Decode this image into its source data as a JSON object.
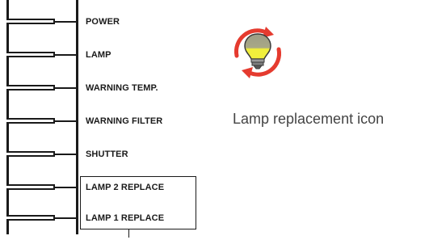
{
  "indicators": [
    {
      "label": "POWER"
    },
    {
      "label": "LAMP"
    },
    {
      "label": "WARNING TEMP."
    },
    {
      "label": "WARNING FILTER"
    },
    {
      "label": "SHUTTER"
    },
    {
      "label": "LAMP 2 REPLACE"
    },
    {
      "label": "LAMP 1 REPLACE"
    }
  ],
  "icon": {
    "name": "lamp-replacement-icon",
    "caption": "Lamp replacement icon",
    "colors": {
      "arrows": "#e53b2f",
      "bulb_top": "#9c9c86",
      "bulb_bottom": "#f1ef3c",
      "base": "#8a8a8a"
    }
  }
}
